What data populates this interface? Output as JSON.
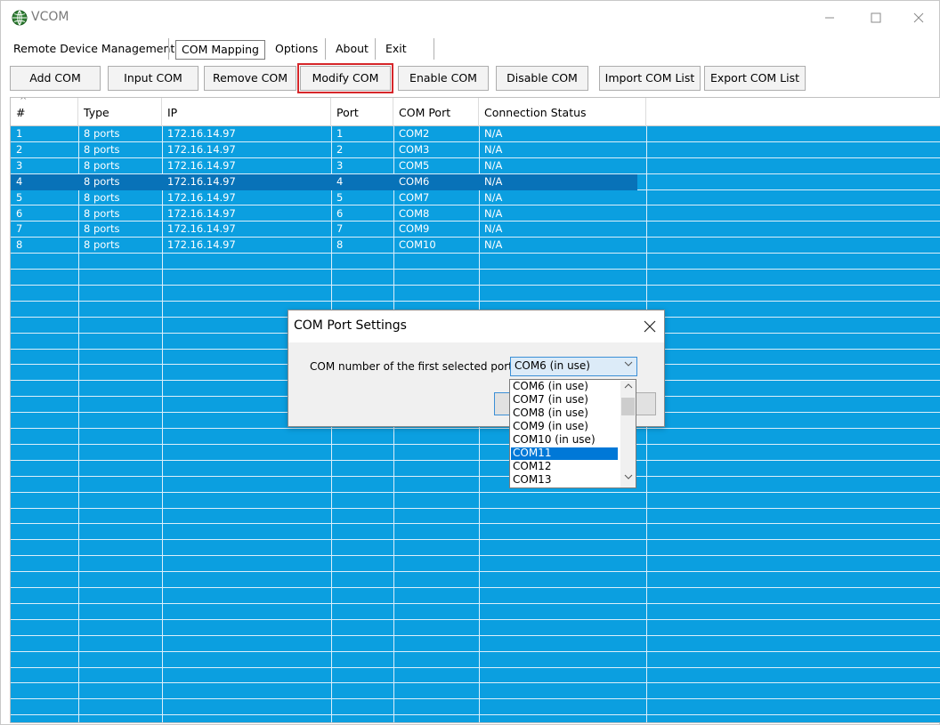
{
  "app": {
    "title": "VCOM"
  },
  "window_controls": {
    "minimize": "—",
    "maximize": "☐",
    "close": "✕"
  },
  "menu": {
    "items": [
      "Remote Device Management",
      "COM Mapping",
      "Options",
      "About",
      "Exit"
    ],
    "active": "COM Mapping"
  },
  "toolbar": {
    "buttons": [
      "Add COM",
      "Input COM",
      "Remove COM",
      "Modify COM",
      "Enable COM",
      "Disable COM",
      "Import COM List",
      "Export COM List"
    ],
    "highlighted": "Modify COM"
  },
  "table": {
    "sort_indicator": "^",
    "columns": [
      "#",
      "Type",
      "IP",
      "Port",
      "COM Port",
      "Connection Status"
    ],
    "rows": [
      [
        "1",
        "8 ports",
        "172.16.14.97",
        "1",
        "COM2",
        "N/A"
      ],
      [
        "2",
        "8 ports",
        "172.16.14.97",
        "2",
        "COM3",
        "N/A"
      ],
      [
        "3",
        "8 ports",
        "172.16.14.97",
        "3",
        "COM5",
        "N/A"
      ],
      [
        "4",
        "8 ports",
        "172.16.14.97",
        "4",
        "COM6",
        "N/A"
      ],
      [
        "5",
        "8 ports",
        "172.16.14.97",
        "5",
        "COM7",
        "N/A"
      ],
      [
        "6",
        "8 ports",
        "172.16.14.97",
        "6",
        "COM8",
        "N/A"
      ],
      [
        "7",
        "8 ports",
        "172.16.14.97",
        "7",
        "COM9",
        "N/A"
      ],
      [
        "8",
        "8 ports",
        "172.16.14.97",
        "8",
        "COM10",
        "N/A"
      ]
    ],
    "selected_row": 4
  },
  "dialog": {
    "title": "COM Port Settings",
    "close": "X",
    "label": "COM number of the first selected port",
    "combo_value": "COM6  (in use)",
    "dropdown_options": [
      "COM6  (in use)",
      "COM7  (in use)",
      "COM8  (in use)",
      "COM9  (in use)",
      "COM10  (in use)",
      "COM11",
      "COM12",
      "COM13"
    ],
    "dropdown_highlighted": "COM11"
  },
  "colors": {
    "grid_background": "#0b9fe0",
    "selected_row": "#0872b8",
    "highlight_border": "#d6262a",
    "dropdown_selected": "#0078d7"
  }
}
